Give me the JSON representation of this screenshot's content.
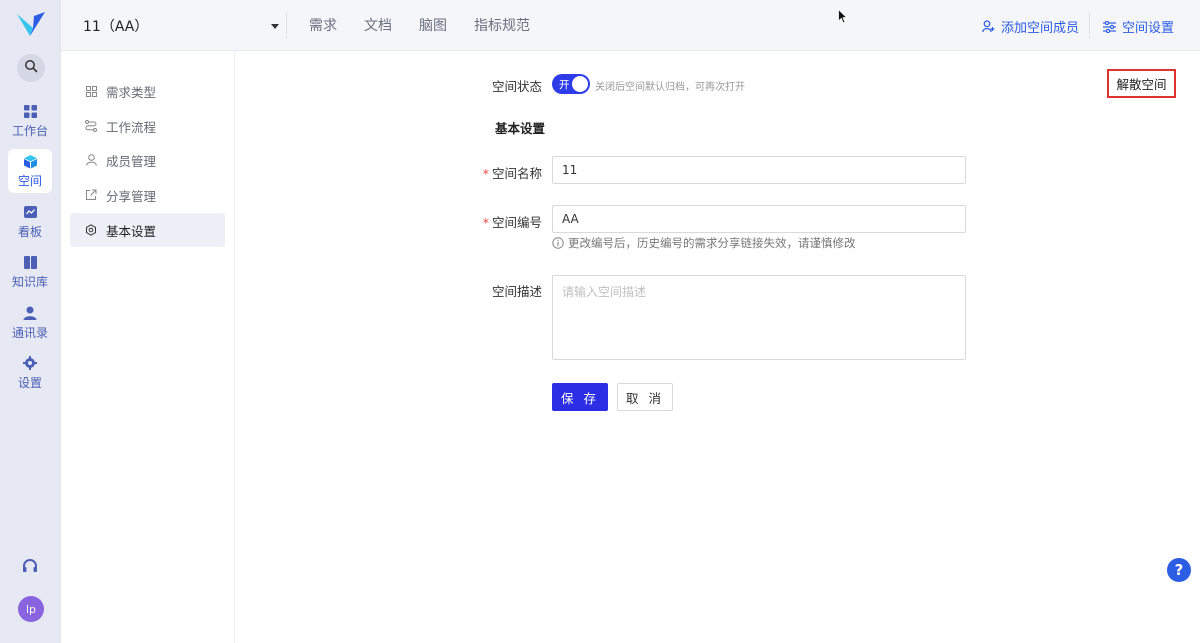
{
  "colors": {
    "accent": "#2c5de5",
    "primary_button": "#2c2ee6",
    "toggle_on": "#2d3ce8",
    "danger_outline": "#e0322f",
    "required": "#e84b3c"
  },
  "rail": {
    "logo_icon": "brand-logo-icon",
    "search_icon": "search-icon",
    "items": [
      {
        "label": "工作台",
        "icon": "grid-icon"
      },
      {
        "label": "空间",
        "icon": "cube-icon"
      },
      {
        "label": "看板",
        "icon": "board-icon"
      },
      {
        "label": "知识库",
        "icon": "book-icon"
      },
      {
        "label": "通讯录",
        "icon": "contacts-icon"
      },
      {
        "label": "设置",
        "icon": "gear-icon"
      }
    ],
    "help_icon": "headset-icon",
    "avatar_text": "lp"
  },
  "header": {
    "space_name": "11（AA）",
    "tabs": [
      "需求",
      "文档",
      "脑图",
      "指标规范"
    ],
    "add_member": "添加空间成员",
    "space_settings": "空间设置"
  },
  "subnav": {
    "items": [
      {
        "label": "需求类型",
        "icon": "grid-icon"
      },
      {
        "label": "工作流程",
        "icon": "flow-icon"
      },
      {
        "label": "成员管理",
        "icon": "user-icon"
      },
      {
        "label": "分享管理",
        "icon": "share-icon"
      },
      {
        "label": "基本设置",
        "icon": "gear-icon"
      }
    ],
    "active_index": 4
  },
  "form": {
    "status_label": "空间状态",
    "status_toggle_text": "开",
    "status_hint": "关闭后空间默认归档，可再次打开",
    "dissolve_button": "解散空间",
    "section_title": "基本设置",
    "name_label": "空间名称",
    "name_value": "11",
    "code_label": "空间编号",
    "code_value": "AA",
    "code_warning": "更改编号后，历史编号的需求分享链接失效，请谨慎修改",
    "desc_label": "空间描述",
    "desc_placeholder": "请输入空间描述",
    "save_button": "保 存",
    "cancel_button": "取 消"
  },
  "help_fab": "?"
}
